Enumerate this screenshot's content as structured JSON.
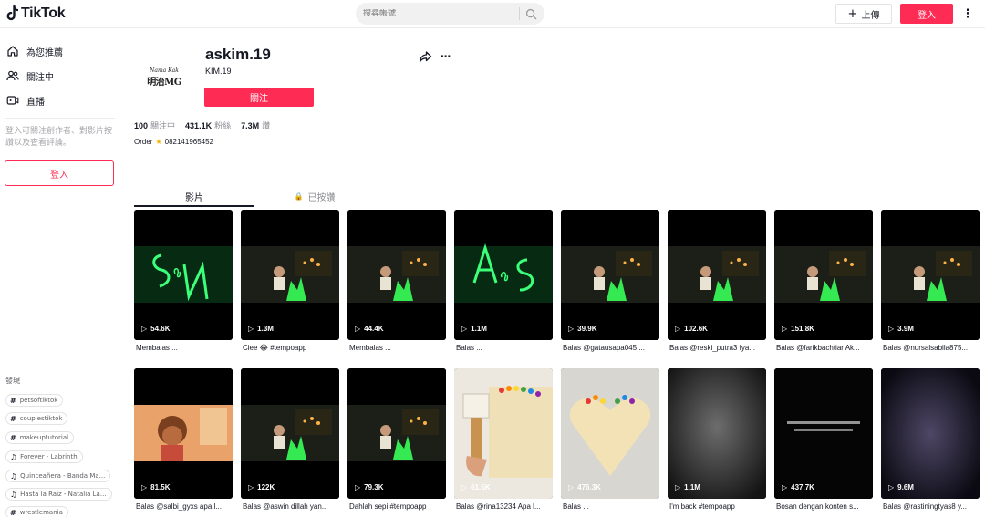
{
  "header": {
    "logo_text": "TikTok",
    "search_placeholder": "搜尋帳號",
    "upload_label": "上傳",
    "login_label": "登入"
  },
  "sidebar": {
    "nav": [
      {
        "label": "為您推薦",
        "icon": "home-icon"
      },
      {
        "label": "關注中",
        "icon": "following-icon"
      },
      {
        "label": "直播",
        "icon": "live-icon"
      }
    ],
    "hint": "登入可關注創作者、對影片按讚以及查看評論。",
    "login_label": "登入",
    "discover_title": "發現",
    "tags": [
      {
        "type": "hashtag",
        "label": "petsoftiktok"
      },
      {
        "type": "hashtag",
        "label": "couplestiktok"
      },
      {
        "type": "hashtag",
        "label": "makeuptutorial"
      },
      {
        "type": "music",
        "label": "Forever - Labrinth"
      },
      {
        "type": "music",
        "label": "Quinceañera - Banda Ma..."
      },
      {
        "type": "music",
        "label": "Hasta la Raíz - Natalia La..."
      },
      {
        "type": "hashtag",
        "label": "wrestlemania"
      }
    ]
  },
  "profile": {
    "avatar_top": "Nama Kak",
    "avatar_bottom": "明治MG",
    "username": "askim.19",
    "nickname": "KIM.19",
    "follow_label": "關注",
    "stats": [
      {
        "value": "100",
        "label": "關注中"
      },
      {
        "value": "431.1K",
        "label": "粉絲"
      },
      {
        "value": "7.3M",
        "label": "讚"
      }
    ],
    "bio_prefix": "Order",
    "bio_suffix": "082141965452"
  },
  "tabs": {
    "videos": "影片",
    "liked": "已按讚"
  },
  "videos": [
    {
      "views": "54.6K",
      "caption": "Membalas ...",
      "thumb": "neon-sn"
    },
    {
      "views": "1.3M",
      "caption": "Ciee 😂 #tempoapp",
      "thumb": "kid-green"
    },
    {
      "views": "44.4K",
      "caption": "Membalas ...",
      "thumb": "kid-green"
    },
    {
      "views": "1.1M",
      "caption": "Balas ...",
      "thumb": "neon-as"
    },
    {
      "views": "39.9K",
      "caption": "Balas @gatausapa045 ...",
      "thumb": "kid-green"
    },
    {
      "views": "102.6K",
      "caption": "Balas @reski_putra3 Iya...",
      "thumb": "kid-green"
    },
    {
      "views": "151.8K",
      "caption": "Balas @farikbachtiar Ak...",
      "thumb": "kid-green"
    },
    {
      "views": "3.9M",
      "caption": "Balas @nursalsabila875...",
      "thumb": "kid-green"
    },
    {
      "views": "81.5K",
      "caption": "Balas @salbi_gyxs apa l...",
      "thumb": "cartoon"
    },
    {
      "views": "122K",
      "caption": "Balas @aswin dillah yan...",
      "thumb": "kid-green"
    },
    {
      "views": "79.3K",
      "caption": "Dahlah sepi #tempoapp",
      "thumb": "kid-green"
    },
    {
      "views": "61.5K",
      "caption": "Balas @rina13234 Apa l...",
      "thumb": "paint-brush"
    },
    {
      "views": "476.3K",
      "caption": "Balas ...",
      "thumb": "heart"
    },
    {
      "views": "1.1M",
      "caption": "I'm back #tempoapp",
      "thumb": "dark-gray"
    },
    {
      "views": "437.7K",
      "caption": "Bosan dengan konten s...",
      "thumb": "dark-text"
    },
    {
      "views": "9.6M",
      "caption": "Balas @rastiningtyas8 y...",
      "thumb": "dark-purple"
    }
  ],
  "colors": {
    "accent": "#fe2c55",
    "text": "#161823",
    "muted": "#8a8b91"
  }
}
